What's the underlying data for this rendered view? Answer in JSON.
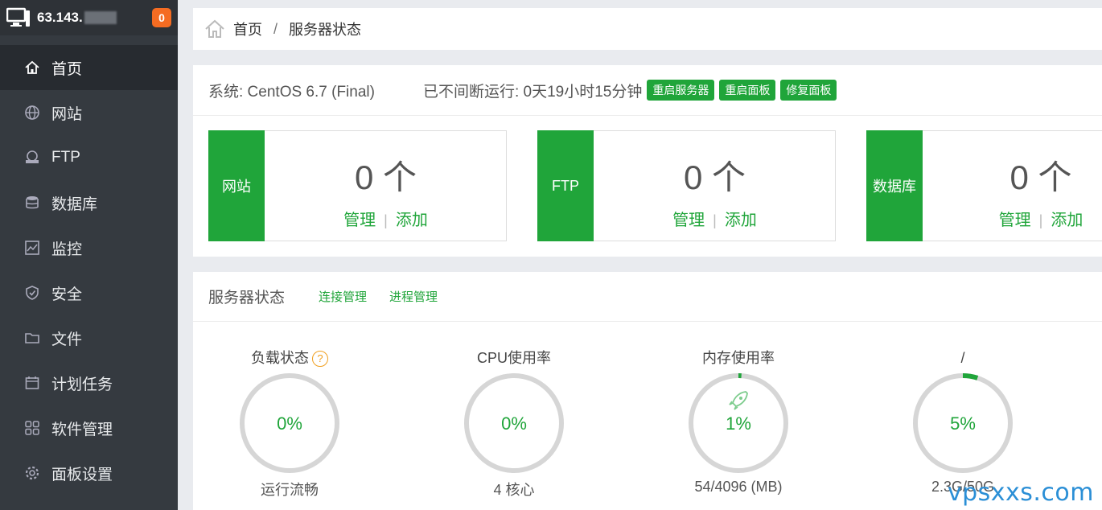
{
  "sidebar": {
    "ip": "63.143.",
    "badge": "0",
    "items": [
      {
        "label": "首页",
        "icon": "home-icon"
      },
      {
        "label": "网站",
        "icon": "globe-icon"
      },
      {
        "label": "FTP",
        "icon": "ftp-icon"
      },
      {
        "label": "数据库",
        "icon": "database-icon"
      },
      {
        "label": "监控",
        "icon": "monitor-chart-icon"
      },
      {
        "label": "安全",
        "icon": "shield-icon"
      },
      {
        "label": "文件",
        "icon": "folder-icon"
      },
      {
        "label": "计划任务",
        "icon": "calendar-icon"
      },
      {
        "label": "软件管理",
        "icon": "apps-grid-icon"
      },
      {
        "label": "面板设置",
        "icon": "gear-icon"
      }
    ]
  },
  "breadcrumb": {
    "home": "首页",
    "sep": "/",
    "current": "服务器状态"
  },
  "system": {
    "os": "系统: CentOS 6.7 (Final)",
    "uptime": "已不间断运行: 0天19小时15分钟",
    "buttons": [
      "重启服务器",
      "重启面板",
      "修复面板"
    ]
  },
  "cards": [
    {
      "tag": "网站",
      "count": "0 个",
      "manage": "管理",
      "sep": "|",
      "add": "添加"
    },
    {
      "tag": "FTP",
      "count": "0 个",
      "manage": "管理",
      "sep": "|",
      "add": "添加"
    },
    {
      "tag": "数据库",
      "count": "0 个",
      "manage": "管理",
      "sep": "|",
      "add": "添加"
    }
  ],
  "status": {
    "title": "服务器状态",
    "links": [
      "连接管理",
      "进程管理"
    ],
    "gauges": [
      {
        "title": "负载状态",
        "help": "?",
        "value": "0%",
        "percent": 0,
        "sub": "运行流畅"
      },
      {
        "title": "CPU使用率",
        "value": "0%",
        "percent": 0,
        "sub": "4 核心"
      },
      {
        "title": "内存使用率",
        "value": "1%",
        "percent": 1,
        "sub": "54/4096 (MB)"
      },
      {
        "title": "/",
        "value": "5%",
        "percent": 5,
        "sub": "2.3G/50G"
      }
    ]
  },
  "colors": {
    "accent": "#20a53a",
    "sidebar": "#353a40",
    "badge": "#f56c22"
  },
  "watermark": "vpsxxs.com"
}
